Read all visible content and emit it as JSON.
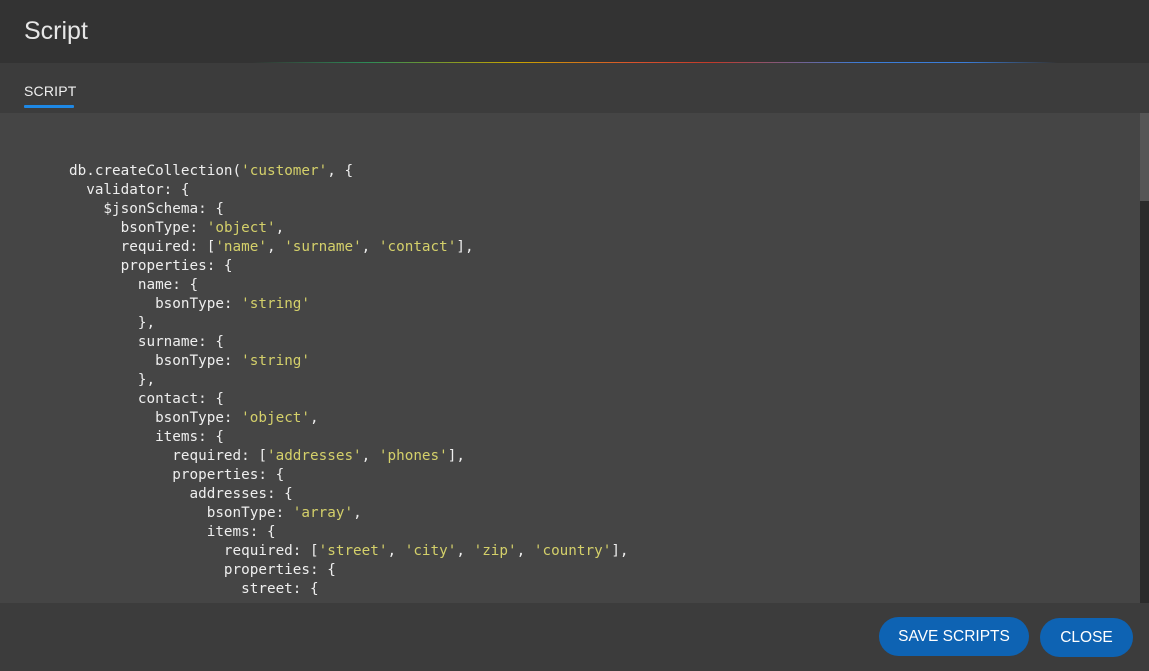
{
  "dialog": {
    "title": "Script"
  },
  "tabs": [
    {
      "label": "SCRIPT",
      "active": true
    }
  ],
  "accent_color": "#1e88e5",
  "button_color": "#0e63b3",
  "string_color": "#d4d06a",
  "code_lines": [
    [
      {
        "t": "db.createCollection("
      },
      {
        "s": "'customer'"
      },
      {
        "t": ", {"
      }
    ],
    [
      {
        "t": "  validator: {"
      }
    ],
    [
      {
        "t": "    $jsonSchema: {"
      }
    ],
    [
      {
        "t": "      bsonType: "
      },
      {
        "s": "'object'"
      },
      {
        "t": ","
      }
    ],
    [
      {
        "t": "      required: ["
      },
      {
        "s": "'name'"
      },
      {
        "t": ", "
      },
      {
        "s": "'surname'"
      },
      {
        "t": ", "
      },
      {
        "s": "'contact'"
      },
      {
        "t": "],"
      }
    ],
    [
      {
        "t": "      properties: {"
      }
    ],
    [
      {
        "t": "        name: {"
      }
    ],
    [
      {
        "t": "          bsonType: "
      },
      {
        "s": "'string'"
      }
    ],
    [
      {
        "t": "        },"
      }
    ],
    [
      {
        "t": "        surname: {"
      }
    ],
    [
      {
        "t": "          bsonType: "
      },
      {
        "s": "'string'"
      }
    ],
    [
      {
        "t": "        },"
      }
    ],
    [
      {
        "t": "        contact: {"
      }
    ],
    [
      {
        "t": "          bsonType: "
      },
      {
        "s": "'object'"
      },
      {
        "t": ","
      }
    ],
    [
      {
        "t": "          items: {"
      }
    ],
    [
      {
        "t": "            required: ["
      },
      {
        "s": "'addresses'"
      },
      {
        "t": ", "
      },
      {
        "s": "'phones'"
      },
      {
        "t": "],"
      }
    ],
    [
      {
        "t": "            properties: {"
      }
    ],
    [
      {
        "t": "              addresses: {"
      }
    ],
    [
      {
        "t": "                bsonType: "
      },
      {
        "s": "'array'"
      },
      {
        "t": ","
      }
    ],
    [
      {
        "t": "                items: {"
      }
    ],
    [
      {
        "t": "                  required: ["
      },
      {
        "s": "'street'"
      },
      {
        "t": ", "
      },
      {
        "s": "'city'"
      },
      {
        "t": ", "
      },
      {
        "s": "'zip'"
      },
      {
        "t": ", "
      },
      {
        "s": "'country'"
      },
      {
        "t": "],"
      }
    ],
    [
      {
        "t": "                  properties: {"
      }
    ],
    [
      {
        "t": "                    street: {"
      }
    ]
  ],
  "scroll": {
    "position_fraction": 0.0,
    "visible_fraction": 0.18
  },
  "footer": {
    "save_label": "SAVE SCRIPTS",
    "close_label": "CLOSE"
  }
}
